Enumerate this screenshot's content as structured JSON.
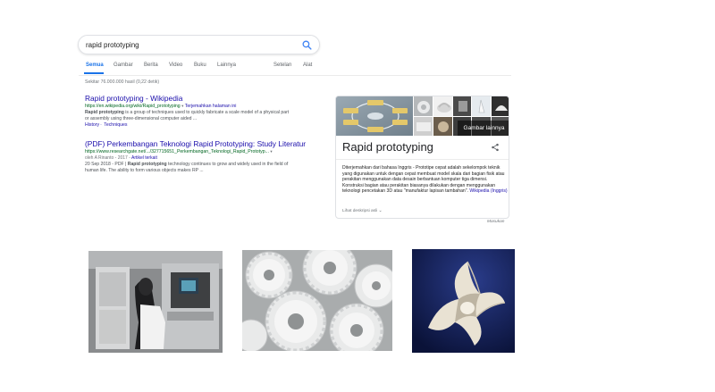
{
  "search": {
    "value": "rapid prototyping"
  },
  "tabs": [
    {
      "label": "Semua",
      "active": true
    },
    {
      "label": "Gambar"
    },
    {
      "label": "Berita"
    },
    {
      "label": "Video"
    },
    {
      "label": "Buku"
    },
    {
      "label": "Lainnya"
    },
    {
      "label": "Setelan"
    },
    {
      "label": "Alat"
    }
  ],
  "result_stats": "Sekitar 76.000.000 hasil (0,22 detik)",
  "results": [
    {
      "title": "Rapid prototyping - Wikipedia",
      "url": "https://en.wikipedia.org/wiki/Rapid_prototyping",
      "translate": "Terjemahkan halaman ini",
      "snippet_bold": "Rapid prototyping",
      "snippet_1": " is a group of techniques used to quickly fabricate a scale model of a physical part",
      "snippet_2": "or assembly using three-dimensional computer aided ...",
      "sitelinks": [
        "History",
        "Techniques"
      ]
    },
    {
      "title": "(PDF) Perkembangan Teknologi Rapid Prototyping: Study Literatur",
      "url": "https://www.researchgate.net/.../327715651_Perkembangan_Teknologi_Rapid_Prototyp...",
      "meta_prefix": "oleh A Rinanto - 2017 - ",
      "meta_link": "Artikel terkait",
      "snippet_prefix": "20 Sep 2018 - PDF | ",
      "snippet_bold": "Rapid prototyping",
      "snippet_1": " technology continues to grow and widely used in the field of",
      "snippet_2": "human life. The ability to form various objects makes RP ..."
    }
  ],
  "knowledge_panel": {
    "title": "Rapid prototyping",
    "more_images": "Gambar lainnya",
    "description": "Diterjemahkan dari bahasa Inggris - Prototipe cepat adalah sekelompok teknik yang digunakan untuk dengan cepat membuat model skala dari bagian fisik atau perakitan menggunakan data desain berbantuan komputer tiga dimensi. Konstruksi bagian atau perakitan biasanya dilakukan dengan menggunakan teknologi pencetakan 3D atau \"manufaktur lapisan tambahan\".",
    "source": "Wikipedia (Inggris)",
    "see_original": "Lihat deskripsi asli"
  },
  "feedback": "Masukan",
  "icons": {
    "search": "search-icon",
    "share": "share-icon",
    "chevron": "chevron-down-icon"
  },
  "colors": {
    "link": "#1a0dab",
    "url": "#006621",
    "accent": "#1a73e8"
  }
}
